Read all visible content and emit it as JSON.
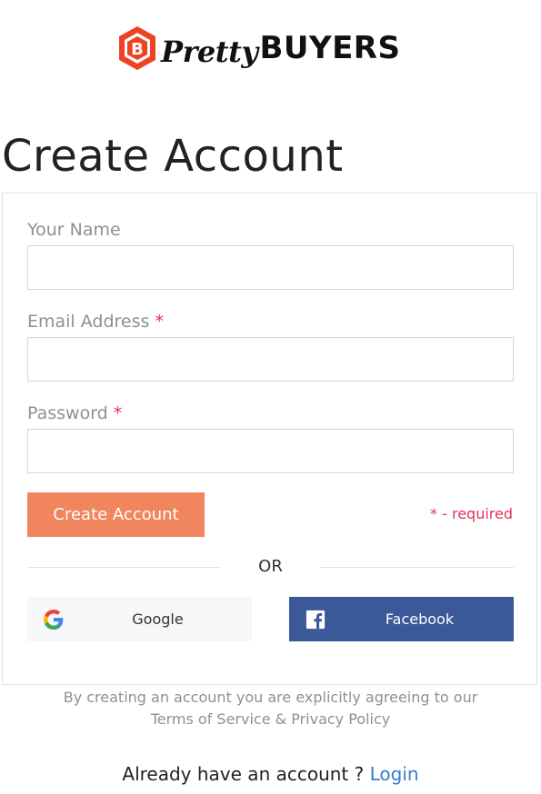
{
  "brand": {
    "script_text": "Pretty",
    "bold_text": "BUYERS",
    "mark_letter": "B",
    "mark_color": "#ef4123"
  },
  "page_title": "Create Account",
  "form": {
    "name": {
      "label": "Your Name",
      "value": "",
      "placeholder": ""
    },
    "email": {
      "label": "Email Address",
      "required_mark": "*",
      "value": "",
      "placeholder": ""
    },
    "password": {
      "label": "Password",
      "required_mark": "*",
      "value": "",
      "placeholder": ""
    },
    "submit_label": "Create Account",
    "required_note": "* - required",
    "divider_text": "OR"
  },
  "social": {
    "google_label": "Google",
    "facebook_label": "Facebook"
  },
  "terms": {
    "line1": "By creating an account you are explicitly agreeing to our",
    "terms_link": "Terms of Service",
    "ampersand": " & ",
    "privacy_link": "Privacy Policy"
  },
  "login": {
    "prompt": "Already have an account ? ",
    "link_label": "Login"
  },
  "colors": {
    "accent": "#f0855e",
    "required": "#e3315b",
    "facebook": "#3b5998",
    "link": "#3a7bd5"
  }
}
